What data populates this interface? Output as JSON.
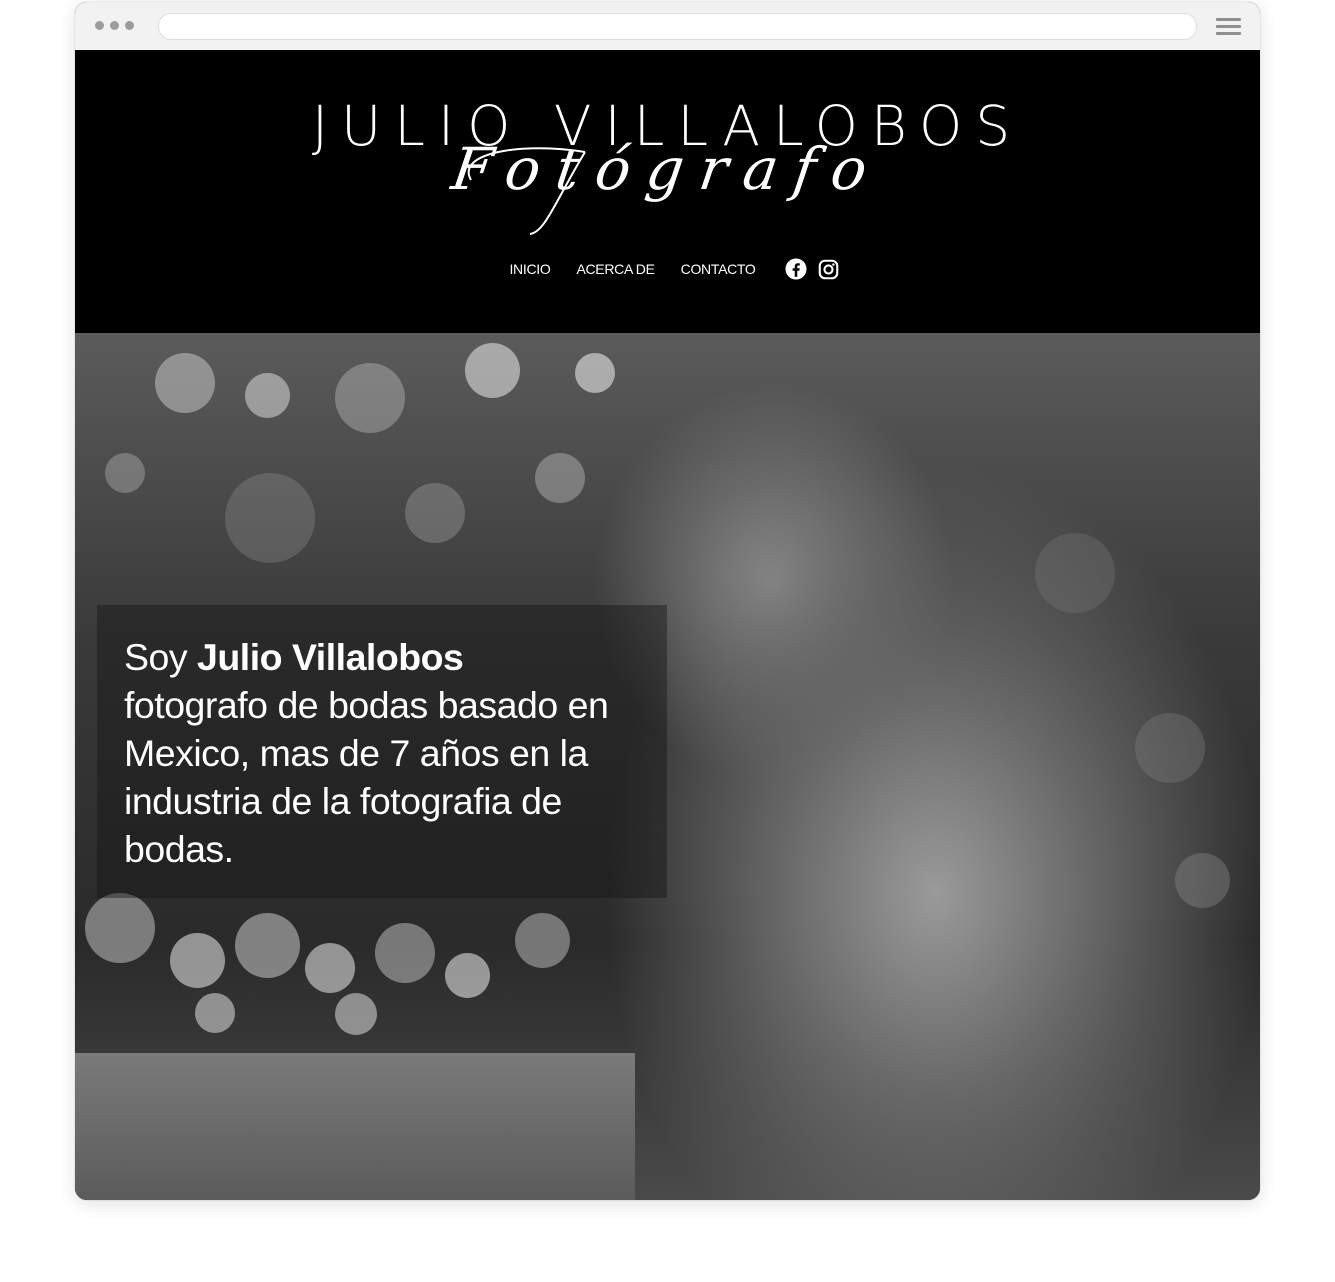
{
  "browser": {
    "icons": {
      "window-dots": "dots-icon",
      "menu": "hamburger-icon"
    }
  },
  "header": {
    "logo": {
      "name": "JULIO VILLALOBOS",
      "tagline": "Fotógrafo"
    },
    "nav": {
      "items": [
        {
          "label": "INICIO"
        },
        {
          "label": "ACERCA DE"
        },
        {
          "label": "CONTACTO"
        }
      ],
      "social_icons": [
        "facebook-icon",
        "instagram-icon"
      ]
    }
  },
  "hero": {
    "intro": {
      "prefix": "Soy ",
      "name": "Julio Villalobos",
      "body": "fotografo de bodas basado en Mexico, mas de 7 años en la industria de la fotografia de bodas."
    }
  },
  "colors": {
    "header_bg": "#000000",
    "text": "#ffffff",
    "chrome_bg": "#f2f2f2"
  }
}
